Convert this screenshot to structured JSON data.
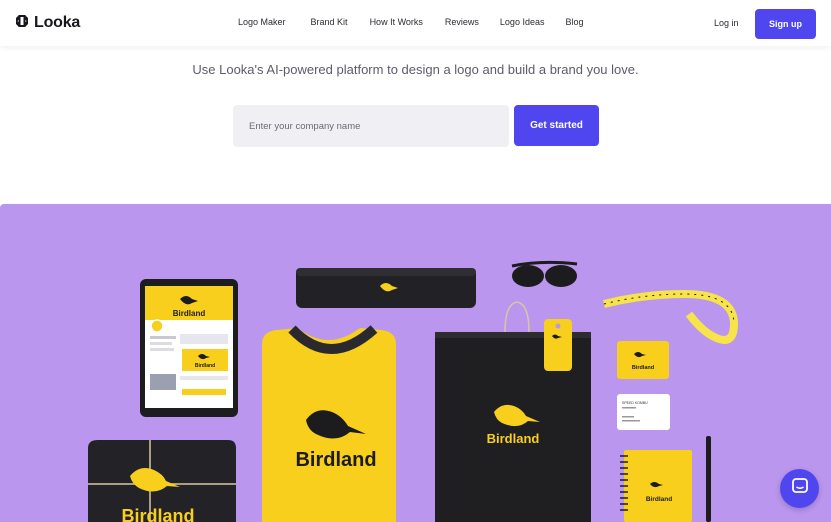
{
  "brand": {
    "name": "Looka"
  },
  "nav": {
    "links": [
      "Logo Maker",
      "Brand Kit",
      "How It Works",
      "Reviews",
      "Logo Ideas",
      "Blog"
    ],
    "login": "Log in",
    "signup": "Sign up"
  },
  "hero": {
    "tagline": "Use Looka's AI-powered platform to design a logo and build a brand you love.",
    "input_placeholder": "Enter your company name",
    "cta": "Get started"
  },
  "mockup": {
    "brand_word": "Birdland",
    "card_name": "SPEED KOMBU",
    "colors": {
      "background": "#ba96ee",
      "yellow": "#f7cf1c",
      "black": "#1c1c1e",
      "accent": "#4f46f0"
    }
  },
  "icons": {
    "logo": "looka-logo-icon",
    "chat": "chat-icon"
  }
}
